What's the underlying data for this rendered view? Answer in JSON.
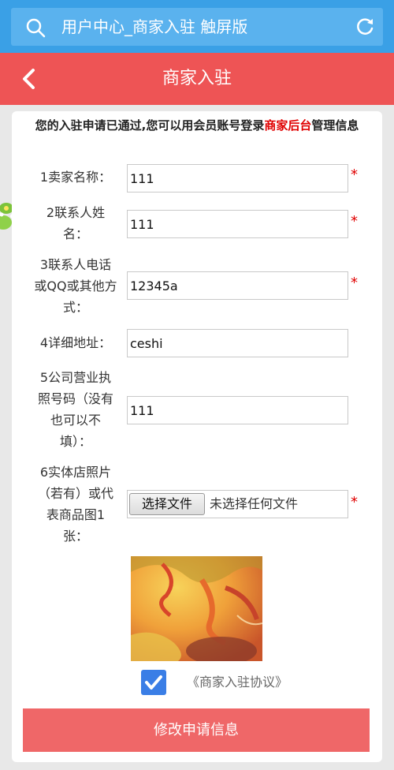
{
  "browser": {
    "title": "用户中心_商家入驻 触屏版"
  },
  "header": {
    "title": "商家入驻"
  },
  "notice": {
    "before": "您的入驻申请已通过,您可以用会员账号登录",
    "highlight": "商家后台",
    "after": "管理信息"
  },
  "form": {
    "fields": [
      {
        "label_lines": [
          "1卖家名称："
        ],
        "value": "111",
        "required_mark": "*"
      },
      {
        "label_lines": [
          "2联系人姓",
          "名："
        ],
        "value": "111",
        "required_mark": "*"
      },
      {
        "label_lines": [
          "3联系人电话",
          "或QQ或其他方",
          "式："
        ],
        "value": "12345a",
        "required_mark": "*"
      },
      {
        "label_lines": [
          "4详细地址："
        ],
        "value": "ceshi"
      },
      {
        "label_lines": [
          "5公司营业执",
          "照号码（没有",
          "也可以不",
          "填）："
        ],
        "value": "111"
      },
      {
        "label_lines": [
          "6实体店照片",
          "（若有）或代",
          "表商品图1",
          "张："
        ],
        "required_mark": "*"
      }
    ],
    "file": {
      "button_label": "选择文件",
      "status": "未选择任何文件"
    },
    "agreement": {
      "text": "《商家入驻协议》",
      "checked": true
    },
    "submit_label": "修改申请信息"
  },
  "colors": {
    "topbar": "#3aa0e6",
    "header": "#ee5455",
    "required": "#e00000",
    "submit": "#ef6768",
    "checkbox": "#3a7ee6"
  }
}
